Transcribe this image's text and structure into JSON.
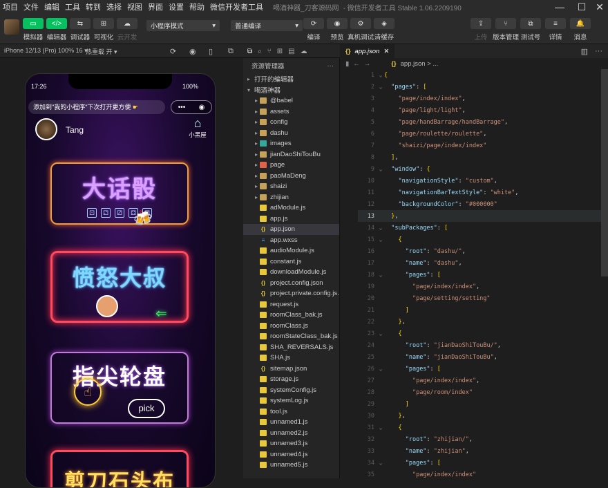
{
  "menu": [
    "项目",
    "文件",
    "编辑",
    "工具",
    "转到",
    "选择",
    "视图",
    "界面",
    "设置",
    "帮助",
    "微信开发者工具"
  ],
  "window_title": "喝酒神器_刀客源码网",
  "window_subtitle": "- 微信开发者工具 Stable 1.06.2209190",
  "toolbar": {
    "left_buttons": [
      {
        "label": "模拟器",
        "icon": "▭"
      },
      {
        "label": "编辑器",
        "icon": "</>"
      },
      {
        "label": "调试器",
        "icon": "⇆"
      },
      {
        "label": "可视化",
        "icon": "⊞"
      },
      {
        "label": "云开发",
        "icon": "☁"
      }
    ],
    "mode_dropdown": "小程序模式",
    "compile_dropdown": "普通编译",
    "mid_buttons": [
      {
        "label": "编译",
        "icon": "⟳"
      },
      {
        "label": "预览",
        "icon": "◉"
      },
      {
        "label": "真机调试",
        "icon": "⚙"
      },
      {
        "label": "清缓存",
        "icon": "◈"
      }
    ],
    "right_buttons": [
      {
        "label": "上传",
        "icon": "⇪"
      },
      {
        "label": "版本管理",
        "icon": "⑂"
      },
      {
        "label": "测试号",
        "icon": "⧉"
      },
      {
        "label": "详情",
        "icon": "≡"
      },
      {
        "label": "消息",
        "icon": "🔔"
      }
    ]
  },
  "statusbar": {
    "device": "iPhone 12/13 (Pro) 100% 16 ▾",
    "hotreload": "热重载 开 ▾"
  },
  "phone": {
    "time": "17:26",
    "battery": "100%",
    "hint": "添加到\"我的小程序\"下次打开更方便",
    "capsule_dots": "•••",
    "capsule_close": "◉",
    "username": "Tang",
    "house_label": "小黑屋",
    "cards": [
      {
        "title": "大话骰"
      },
      {
        "title": "愤怒大叔"
      },
      {
        "title": "指尖轮盘"
      },
      {
        "title": "剪刀石头布"
      }
    ],
    "pick_label": "pick",
    "dice_faces": [
      "⚀",
      "⚁",
      "⚂",
      "⚃",
      "⚄"
    ]
  },
  "explorer": {
    "title": "资源管理器",
    "more": "···",
    "open_editors": "打开的编辑器",
    "project": "喝酒神器",
    "items": [
      {
        "name": "@babel",
        "type": "folder",
        "arrow": "▸"
      },
      {
        "name": "assets",
        "type": "folder",
        "arrow": "▸"
      },
      {
        "name": "config",
        "type": "folder",
        "arrow": "▸"
      },
      {
        "name": "dashu",
        "type": "folder",
        "arrow": "▸"
      },
      {
        "name": "images",
        "type": "folderteal",
        "arrow": "▸"
      },
      {
        "name": "jianDaoShiTouBu",
        "type": "folder",
        "arrow": "▸"
      },
      {
        "name": "page",
        "type": "folderred",
        "arrow": "▸"
      },
      {
        "name": "paoMaDeng",
        "type": "folder",
        "arrow": "▸"
      },
      {
        "name": "shaizi",
        "type": "folder",
        "arrow": "▸"
      },
      {
        "name": "zhijian",
        "type": "folder",
        "arrow": "▸"
      },
      {
        "name": "adModule.js",
        "type": "js",
        "arrow": ""
      },
      {
        "name": "app.js",
        "type": "js",
        "arrow": ""
      },
      {
        "name": "app.json",
        "type": "json",
        "arrow": "",
        "selected": true
      },
      {
        "name": "app.wxss",
        "type": "wxss",
        "arrow": ""
      },
      {
        "name": "audioModule.js",
        "type": "js",
        "arrow": ""
      },
      {
        "name": "constant.js",
        "type": "js",
        "arrow": ""
      },
      {
        "name": "downloadModule.js",
        "type": "js",
        "arrow": ""
      },
      {
        "name": "project.config.json",
        "type": "json",
        "arrow": ""
      },
      {
        "name": "project.private.config.js...",
        "type": "json",
        "arrow": ""
      },
      {
        "name": "request.js",
        "type": "js",
        "arrow": ""
      },
      {
        "name": "roomClass_bak.js",
        "type": "js",
        "arrow": ""
      },
      {
        "name": "roomClass.js",
        "type": "js",
        "arrow": ""
      },
      {
        "name": "roomStateClass_bak.js",
        "type": "js",
        "arrow": ""
      },
      {
        "name": "SHA_REVERSALS.js",
        "type": "js",
        "arrow": ""
      },
      {
        "name": "SHA.js",
        "type": "js",
        "arrow": ""
      },
      {
        "name": "sitemap.json",
        "type": "json",
        "arrow": ""
      },
      {
        "name": "storage.js",
        "type": "js",
        "arrow": ""
      },
      {
        "name": "systemConfig.js",
        "type": "js",
        "arrow": ""
      },
      {
        "name": "systemLog.js",
        "type": "js",
        "arrow": ""
      },
      {
        "name": "tool.js",
        "type": "js",
        "arrow": ""
      },
      {
        "name": "unnamed1.js",
        "type": "js",
        "arrow": ""
      },
      {
        "name": "unnamed2.js",
        "type": "js",
        "arrow": ""
      },
      {
        "name": "unnamed3.js",
        "type": "js",
        "arrow": ""
      },
      {
        "name": "unnamed4.js",
        "type": "js",
        "arrow": ""
      },
      {
        "name": "unnamed5.js",
        "type": "js",
        "arrow": ""
      }
    ]
  },
  "editor": {
    "tab_label": "app.json",
    "tab_close": "✕",
    "breadcrumb": "app.json > ...",
    "current_line": 13,
    "lines": [
      {
        "n": "1",
        "fold": "⌄",
        "t": [
          [
            "b",
            "{"
          ]
        ]
      },
      {
        "n": "2",
        "fold": "⌄",
        "t": [
          [
            "p",
            "  "
          ],
          [
            "k",
            "\"pages\""
          ],
          [
            "p",
            ": "
          ],
          [
            "b",
            "["
          ]
        ]
      },
      {
        "n": "3",
        "fold": "",
        "t": [
          [
            "p",
            "    "
          ],
          [
            "s",
            "\"page/index/index\""
          ],
          [
            "p",
            ","
          ]
        ]
      },
      {
        "n": "4",
        "fold": "",
        "t": [
          [
            "p",
            "    "
          ],
          [
            "s",
            "\"page/light/light\""
          ],
          [
            "p",
            ","
          ]
        ]
      },
      {
        "n": "5",
        "fold": "",
        "t": [
          [
            "p",
            "    "
          ],
          [
            "s",
            "\"page/handBarrage/handBarrage\""
          ],
          [
            "p",
            ","
          ]
        ]
      },
      {
        "n": "6",
        "fold": "",
        "t": [
          [
            "p",
            "    "
          ],
          [
            "s",
            "\"page/roulette/roulette\""
          ],
          [
            "p",
            ","
          ]
        ]
      },
      {
        "n": "7",
        "fold": "",
        "t": [
          [
            "p",
            "    "
          ],
          [
            "s",
            "\"shaizi/page/index/index\""
          ]
        ]
      },
      {
        "n": "8",
        "fold": "",
        "t": [
          [
            "p",
            "  "
          ],
          [
            "b",
            "]"
          ],
          [
            "p",
            ","
          ]
        ]
      },
      {
        "n": "9",
        "fold": "⌄",
        "t": [
          [
            "p",
            "  "
          ],
          [
            "k",
            "\"window\""
          ],
          [
            "p",
            ": "
          ],
          [
            "b",
            "{"
          ]
        ]
      },
      {
        "n": "10",
        "fold": "",
        "t": [
          [
            "p",
            "    "
          ],
          [
            "k",
            "\"navigationStyle\""
          ],
          [
            "p",
            ": "
          ],
          [
            "s",
            "\"custom\""
          ],
          [
            "p",
            ","
          ]
        ]
      },
      {
        "n": "11",
        "fold": "",
        "t": [
          [
            "p",
            "    "
          ],
          [
            "k",
            "\"navigationBarTextStyle\""
          ],
          [
            "p",
            ": "
          ],
          [
            "s",
            "\"white\""
          ],
          [
            "p",
            ","
          ]
        ]
      },
      {
        "n": "12",
        "fold": "",
        "t": [
          [
            "p",
            "    "
          ],
          [
            "k",
            "\"backgroundColor\""
          ],
          [
            "p",
            ": "
          ],
          [
            "s",
            "\"#000000\""
          ]
        ]
      },
      {
        "n": "13",
        "fold": "",
        "t": [
          [
            "p",
            "  "
          ],
          [
            "b",
            "}"
          ],
          [
            "p",
            ","
          ]
        ]
      },
      {
        "n": "14",
        "fold": "⌄",
        "t": [
          [
            "p",
            "  "
          ],
          [
            "k",
            "\"subPackages\""
          ],
          [
            "p",
            ": "
          ],
          [
            "b",
            "["
          ]
        ]
      },
      {
        "n": "15",
        "fold": "⌄",
        "t": [
          [
            "p",
            "    "
          ],
          [
            "b",
            "{"
          ]
        ]
      },
      {
        "n": "16",
        "fold": "",
        "t": [
          [
            "p",
            "      "
          ],
          [
            "k",
            "\"root\""
          ],
          [
            "p",
            ": "
          ],
          [
            "s",
            "\"dashu/\""
          ],
          [
            "p",
            ","
          ]
        ]
      },
      {
        "n": "17",
        "fold": "",
        "t": [
          [
            "p",
            "      "
          ],
          [
            "k",
            "\"name\""
          ],
          [
            "p",
            ": "
          ],
          [
            "s",
            "\"dashu\""
          ],
          [
            "p",
            ","
          ]
        ]
      },
      {
        "n": "18",
        "fold": "⌄",
        "t": [
          [
            "p",
            "      "
          ],
          [
            "k",
            "\"pages\""
          ],
          [
            "p",
            ": "
          ],
          [
            "b",
            "["
          ]
        ]
      },
      {
        "n": "19",
        "fold": "",
        "t": [
          [
            "p",
            "        "
          ],
          [
            "s",
            "\"page/index/index\""
          ],
          [
            "p",
            ","
          ]
        ]
      },
      {
        "n": "20",
        "fold": "",
        "t": [
          [
            "p",
            "        "
          ],
          [
            "s",
            "\"page/setting/setting\""
          ]
        ]
      },
      {
        "n": "21",
        "fold": "",
        "t": [
          [
            "p",
            "      "
          ],
          [
            "b",
            "]"
          ]
        ]
      },
      {
        "n": "22",
        "fold": "",
        "t": [
          [
            "p",
            "    "
          ],
          [
            "b",
            "}"
          ],
          [
            "p",
            ","
          ]
        ]
      },
      {
        "n": "23",
        "fold": "⌄",
        "t": [
          [
            "p",
            "    "
          ],
          [
            "b",
            "{"
          ]
        ]
      },
      {
        "n": "24",
        "fold": "",
        "t": [
          [
            "p",
            "      "
          ],
          [
            "k",
            "\"root\""
          ],
          [
            "p",
            ": "
          ],
          [
            "s",
            "\"jianDaoShiTouBu/\""
          ],
          [
            "p",
            ","
          ]
        ]
      },
      {
        "n": "25",
        "fold": "",
        "t": [
          [
            "p",
            "      "
          ],
          [
            "k",
            "\"name\""
          ],
          [
            "p",
            ": "
          ],
          [
            "s",
            "\"jianDaoShiTouBu\""
          ],
          [
            "p",
            ","
          ]
        ]
      },
      {
        "n": "26",
        "fold": "⌄",
        "t": [
          [
            "p",
            "      "
          ],
          [
            "k",
            "\"pages\""
          ],
          [
            "p",
            ": "
          ],
          [
            "b",
            "["
          ]
        ]
      },
      {
        "n": "27",
        "fold": "",
        "t": [
          [
            "p",
            "        "
          ],
          [
            "s",
            "\"page/index/index\""
          ],
          [
            "p",
            ","
          ]
        ]
      },
      {
        "n": "28",
        "fold": "",
        "t": [
          [
            "p",
            "        "
          ],
          [
            "s",
            "\"page/room/index\""
          ]
        ]
      },
      {
        "n": "29",
        "fold": "",
        "t": [
          [
            "p",
            "      "
          ],
          [
            "b",
            "]"
          ]
        ]
      },
      {
        "n": "30",
        "fold": "",
        "t": [
          [
            "p",
            "    "
          ],
          [
            "b",
            "}"
          ],
          [
            "p",
            ","
          ]
        ]
      },
      {
        "n": "31",
        "fold": "⌄",
        "t": [
          [
            "p",
            "    "
          ],
          [
            "b",
            "{"
          ]
        ]
      },
      {
        "n": "32",
        "fold": "",
        "t": [
          [
            "p",
            "      "
          ],
          [
            "k",
            "\"root\""
          ],
          [
            "p",
            ": "
          ],
          [
            "s",
            "\"zhijian/\""
          ],
          [
            "p",
            ","
          ]
        ]
      },
      {
        "n": "33",
        "fold": "",
        "t": [
          [
            "p",
            "      "
          ],
          [
            "k",
            "\"name\""
          ],
          [
            "p",
            ": "
          ],
          [
            "s",
            "\"zhijian\""
          ],
          [
            "p",
            ","
          ]
        ]
      },
      {
        "n": "34",
        "fold": "⌄",
        "t": [
          [
            "p",
            "      "
          ],
          [
            "k",
            "\"pages\""
          ],
          [
            "p",
            ": "
          ],
          [
            "b",
            "["
          ]
        ]
      },
      {
        "n": "35",
        "fold": "",
        "t": [
          [
            "p",
            "        "
          ],
          [
            "s",
            "\"page/index/index\""
          ]
        ]
      }
    ]
  }
}
